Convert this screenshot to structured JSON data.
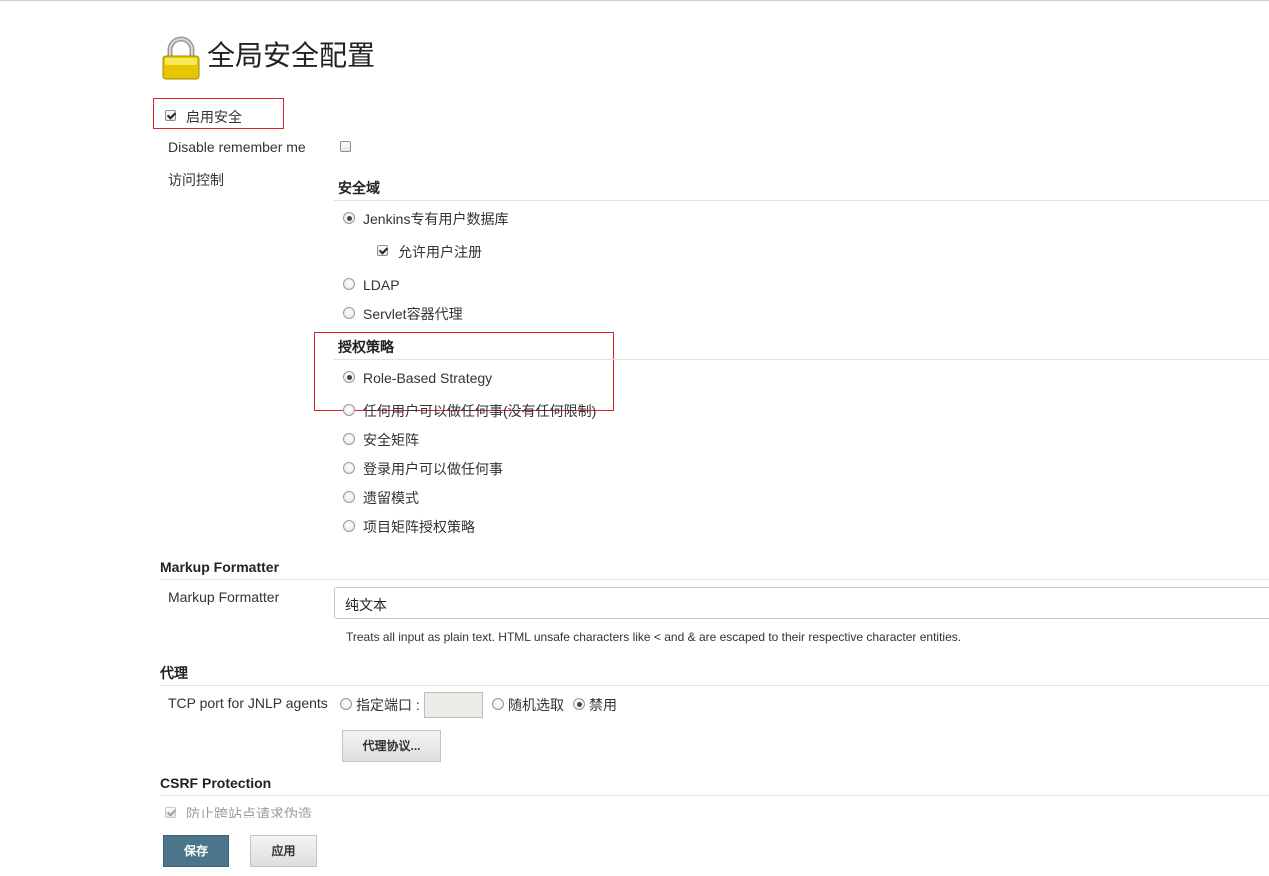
{
  "header": {
    "title": "全局安全配置"
  },
  "enable_security": {
    "label": "启用安全",
    "checked": true
  },
  "disable_remember_me": {
    "label": "Disable remember me",
    "checked": false
  },
  "access_control": {
    "label": "访问控制",
    "security_realm": {
      "title": "安全域",
      "options": [
        {
          "label": "Jenkins专有用户数据库",
          "selected": true
        },
        {
          "label": "LDAP",
          "selected": false
        },
        {
          "label": "Servlet容器代理",
          "selected": false
        }
      ],
      "allow_signup": {
        "label": "允许用户注册",
        "checked": true
      }
    },
    "authorization": {
      "title": "授权策略",
      "options": [
        {
          "label": "Role-Based Strategy",
          "selected": true
        },
        {
          "label": "任何用户可以做任何事(没有任何限制)",
          "selected": false
        },
        {
          "label": "安全矩阵",
          "selected": false
        },
        {
          "label": "登录用户可以做任何事",
          "selected": false
        },
        {
          "label": "遗留模式",
          "selected": false
        },
        {
          "label": "项目矩阵授权策略",
          "selected": false
        }
      ]
    }
  },
  "markup_formatter": {
    "section_title": "Markup Formatter",
    "label": "Markup Formatter",
    "selected_value": "纯文本",
    "description": "Treats all input as plain text. HTML unsafe characters like < and & are escaped to their respective character entities."
  },
  "proxy": {
    "section_title": "代理",
    "tcp_label": "TCP port for JNLP agents",
    "options": [
      {
        "label": "指定端口 :",
        "selected": false
      },
      {
        "label": "随机选取",
        "selected": false
      },
      {
        "label": "禁用",
        "selected": true
      }
    ],
    "port_value": "",
    "protocols_button": "代理协议..."
  },
  "csrf": {
    "section_title": "CSRF Protection",
    "prevent_label": "防止跨站点请求伪造",
    "checked": true
  },
  "buttons": {
    "save": "保存",
    "apply": "应用"
  },
  "colors": {
    "primary_button": "#4b758b",
    "annotation_red": "#d9232a"
  }
}
